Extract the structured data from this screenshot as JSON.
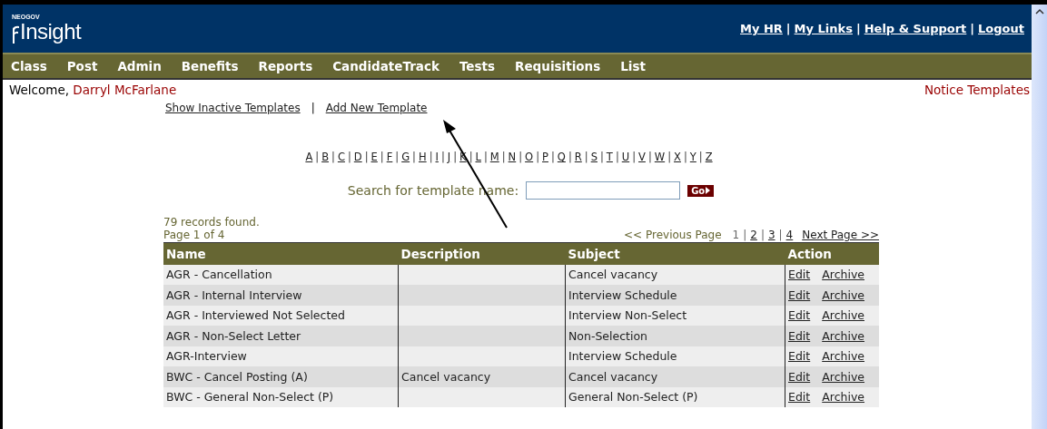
{
  "header": {
    "logo_small": "NEOGOV",
    "logo": "Insight",
    "links": [
      "My HR",
      "My Links",
      "Help & Support",
      "Logout"
    ],
    "separator": "|"
  },
  "nav": [
    "Class",
    "Post",
    "Admin",
    "Benefits",
    "Reports",
    "CandidateTrack",
    "Tests",
    "Requisitions",
    "List"
  ],
  "welcome": {
    "label": "Welcome,",
    "user": "Darryl McFarlane",
    "page_title": "Notice Templates"
  },
  "actions": {
    "items": [
      "Show Inactive Templates",
      "Add New Template"
    ],
    "separator": "|"
  },
  "alphabet": {
    "separator": "|",
    "letters": [
      "A",
      "B",
      "C",
      "D",
      "E",
      "F",
      "G",
      "H",
      "I",
      "J",
      "K",
      "L",
      "M",
      "N",
      "O",
      "P",
      "Q",
      "R",
      "S",
      "T",
      "U",
      "V",
      "W",
      "X",
      "Y",
      "Z"
    ]
  },
  "search": {
    "label": "Search for template name:",
    "button": "Go"
  },
  "summary": {
    "records": "79 records found.",
    "page": "Page 1 of 4"
  },
  "pager": {
    "previous": "<< Previous Page",
    "next": "Next Page >>",
    "separator": "|",
    "pages": [
      {
        "label": "1",
        "selected": true
      },
      {
        "label": "2",
        "selected": false
      },
      {
        "label": "3",
        "selected": false
      },
      {
        "label": "4",
        "selected": false
      }
    ]
  },
  "table": {
    "columns": [
      "Name",
      "Description",
      "Subject",
      "Action"
    ],
    "rows": [
      {
        "name": "AGR - Cancellation",
        "description": "",
        "subject": "Cancel vacancy",
        "actions": [
          "Edit",
          "Archive"
        ]
      },
      {
        "name": "AGR - Internal Interview",
        "description": "",
        "subject": "Interview Schedule",
        "actions": [
          "Edit",
          "Archive"
        ]
      },
      {
        "name": "AGR - Interviewed Not Selected",
        "description": "",
        "subject": "Interview Non-Select",
        "actions": [
          "Edit",
          "Archive"
        ]
      },
      {
        "name": "AGR - Non-Select Letter",
        "description": "",
        "subject": "Non-Selection",
        "actions": [
          "Edit",
          "Archive"
        ]
      },
      {
        "name": "AGR-Interview",
        "description": "",
        "subject": "Interview Schedule",
        "actions": [
          "Edit",
          "Archive"
        ]
      },
      {
        "name": "BWC - Cancel Posting (A)",
        "description": "Cancel vacancy",
        "subject": "Cancel vacancy",
        "actions": [
          "Edit",
          "Archive"
        ]
      },
      {
        "name": "BWC - General Non-Select (P)",
        "description": "",
        "subject": "General Non-Select (P)",
        "actions": [
          "Edit",
          "Archive"
        ]
      }
    ]
  }
}
